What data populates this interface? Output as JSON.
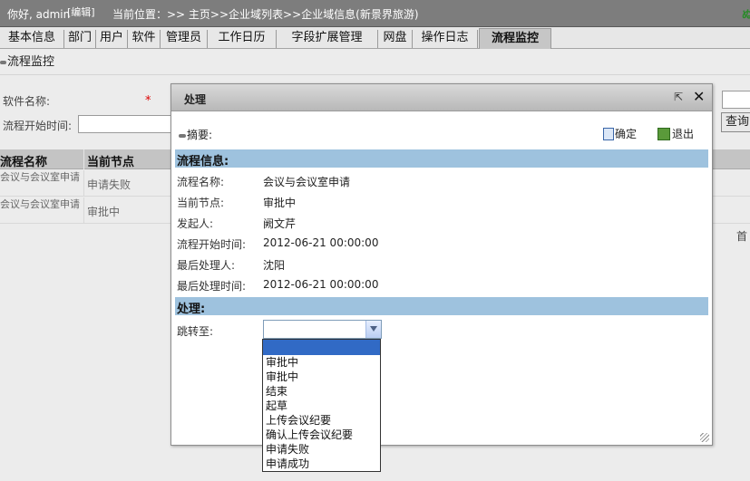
{
  "header": {
    "greeting": "你好, admin",
    "edit_label": "[编辑]",
    "breadcrumb": "当前位置：>> 主页>>企业域列表>>企业域信息(新景界旅游)",
    "corner_glyph": "ぬ"
  },
  "tabs": [
    {
      "label": "基本信息"
    },
    {
      "label": "部门"
    },
    {
      "label": "用户"
    },
    {
      "label": "软件"
    },
    {
      "label": "管理员"
    },
    {
      "label": "工作日历"
    },
    {
      "label": "字段扩展管理"
    },
    {
      "label": "网盘"
    },
    {
      "label": "操作日志"
    },
    {
      "label": "流程监控"
    }
  ],
  "page": {
    "title": "流程监控",
    "software_label": "软件名称:",
    "required_mark": "*",
    "start_time_label": "流程开始时间:",
    "query_label": "查询",
    "columns": [
      "流程名称",
      "当前节点"
    ],
    "rows": [
      {
        "name": "会议与会议室申请",
        "node": "申请失败"
      },
      {
        "name": "会议与会议室申请",
        "node": "审批中"
      }
    ],
    "pager_text": "首"
  },
  "dialog": {
    "title": "处理",
    "summary_label": "摘要:",
    "ok_label": "确定",
    "exit_label": "退出",
    "info_section": "流程信息:",
    "info": [
      {
        "label": "流程名称:",
        "value": "会议与会议室申请"
      },
      {
        "label": "当前节点:",
        "value": "审批中"
      },
      {
        "label": "发起人:",
        "value": "阙文芹"
      },
      {
        "label": "流程开始时间:",
        "value": "2012-06-21 00:00:00"
      },
      {
        "label": "最后处理人:",
        "value": "沈阳"
      },
      {
        "label": "最后处理时间:",
        "value": "2012-06-21 00:00:00"
      }
    ],
    "process_section": "处理:",
    "jump_label": "跳转至:",
    "jump_selected": "",
    "jump_options": [
      "",
      "审批中",
      "审批中",
      "结束",
      "起草",
      "上传会议纪要",
      "确认上传会议纪要",
      "申请失败",
      "申请成功"
    ]
  },
  "colors": {
    "header_bg": "#7d7d7d",
    "section_bg": "#9ec2de",
    "highlight": "#316ac5"
  }
}
